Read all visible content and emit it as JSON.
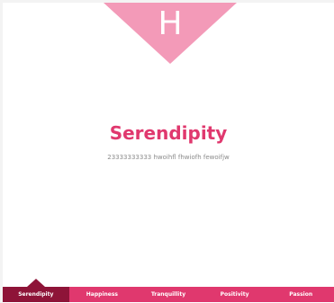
{
  "banner": {
    "letter": "H",
    "color": "#f39ab8"
  },
  "content": {
    "title": "Serendipity",
    "subtitle": "23333333333 hwoihfl fhwiofh fewoifjw"
  },
  "tabs": [
    {
      "label": "Serendipity",
      "active": true
    },
    {
      "label": "Happiness",
      "active": false
    },
    {
      "label": "Tranquillity",
      "active": false
    },
    {
      "label": "Positivity",
      "active": false
    },
    {
      "label": "Passion",
      "active": false
    }
  ],
  "colors": {
    "accent": "#e0386e",
    "active_tab": "#8e1438",
    "subtitle": "#8a8a8a"
  }
}
